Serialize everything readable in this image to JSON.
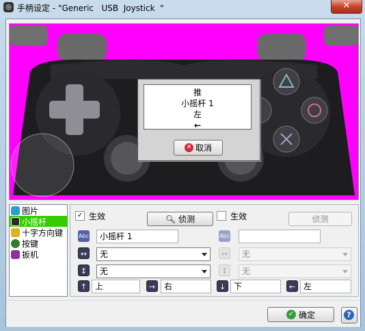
{
  "window": {
    "title": "手柄设定 - \"Generic   USB  Joystick  \"",
    "close_glyph": "✕"
  },
  "overlay": {
    "line1": "推",
    "line2": "小摇杆 1",
    "line3": "左",
    "arrow_glyph": "←",
    "cancel_label": "取消"
  },
  "sidebar": {
    "items": [
      {
        "label": "图片",
        "icon": "picture-icon",
        "color": "#2a9fd6"
      },
      {
        "label": "小摇杆",
        "icon": "stick-icon",
        "color": "#2b2b2b"
      },
      {
        "label": "十字方向键",
        "icon": "dpad-icon",
        "color": "#e0b020"
      },
      {
        "label": "按键",
        "icon": "button-icon",
        "color": "#2f7d2f"
      },
      {
        "label": "扳机",
        "icon": "trigger-icon",
        "color": "#9030a0"
      }
    ],
    "selected_index": 1
  },
  "left_col": {
    "enabled_label": "生效",
    "enabled_checked": true,
    "detect_label": "侦测",
    "name_value": "小摇杆 1",
    "axis_h_value": "无",
    "axis_v_value": "无"
  },
  "right_col": {
    "enabled_label": "生效",
    "enabled_checked": false,
    "detect_label": "侦测",
    "name_value": "",
    "axis_h_value": "无",
    "axis_v_value": "无"
  },
  "directions": {
    "up": "上",
    "right": "右",
    "down": "下",
    "left": "左"
  },
  "footer": {
    "ok_label": "确定",
    "help_glyph": "?"
  },
  "colors": {
    "background_key": "#ff00ff",
    "selected_item": "#33cc00"
  }
}
